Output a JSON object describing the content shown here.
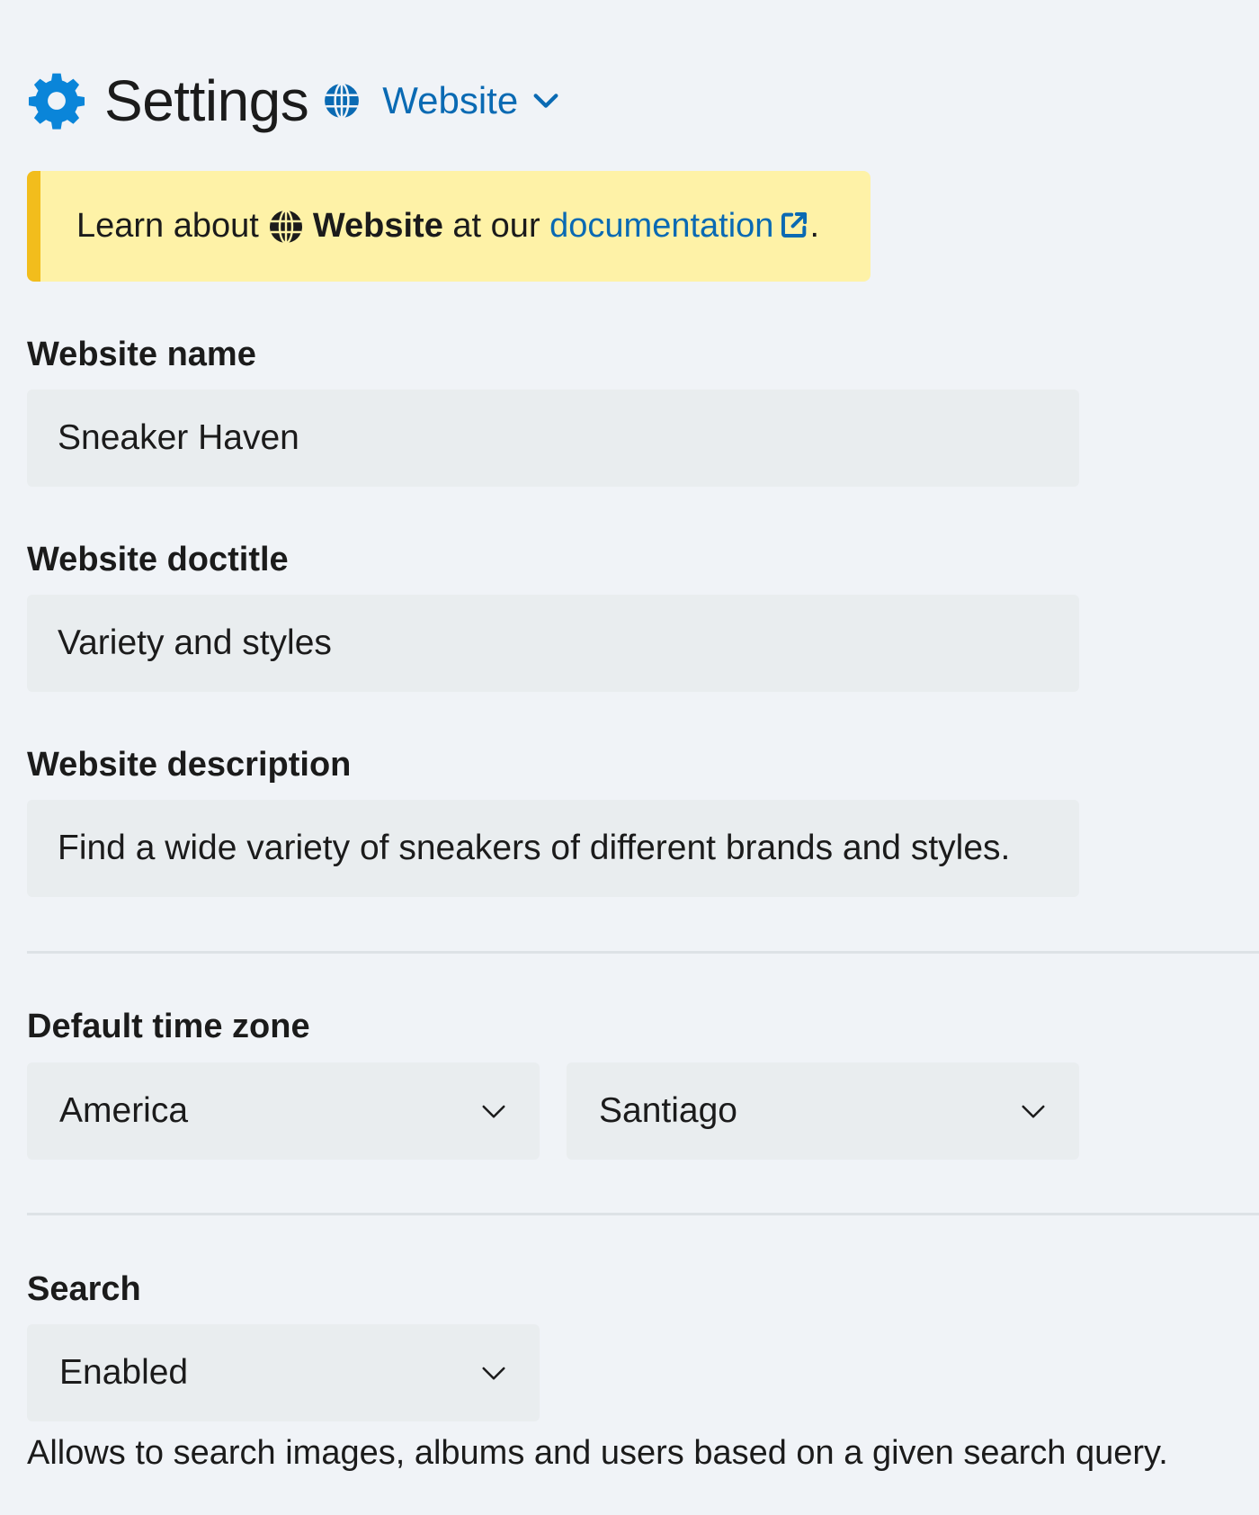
{
  "header": {
    "title": "Settings",
    "scope_label": "Website"
  },
  "notice": {
    "prefix": "Learn about",
    "subject": "Website",
    "middle": "at our",
    "link_text": "documentation",
    "suffix": "."
  },
  "fields": {
    "website_name": {
      "label": "Website name",
      "value": "Sneaker Haven"
    },
    "website_doctitle": {
      "label": "Website doctitle",
      "value": "Variety and styles"
    },
    "website_description": {
      "label": "Website description",
      "value": "Find a wide variety of sneakers of different brands and styles."
    }
  },
  "timezone": {
    "label": "Default time zone",
    "region": "America",
    "city": "Santiago"
  },
  "search": {
    "label": "Search",
    "value": "Enabled",
    "help": "Allows to search images, albums and users based on a given search query."
  },
  "colors": {
    "accent": "#0a6ab3",
    "notice_bg": "#fef2a7",
    "notice_border": "#f2bd1c",
    "background": "#f0f3f7",
    "field_bg": "#e9edef"
  }
}
